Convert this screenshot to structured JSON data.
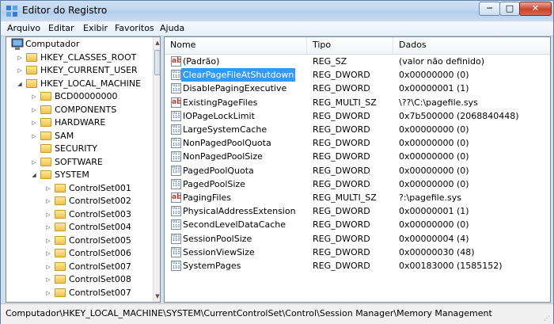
{
  "window": {
    "title": "Editor do Registro",
    "controls": {
      "minimize": "─",
      "maximize": "□",
      "close": "✕"
    }
  },
  "menu": [
    "Arquivo",
    "Editar",
    "Exibir",
    "Favoritos",
    "Ajuda"
  ],
  "tree": [
    {
      "label": "Computador",
      "level": 0,
      "expander": "expanded",
      "icon": "computer-icon"
    },
    {
      "label": "HKEY_CLASSES_ROOT",
      "level": 1,
      "expander": "collapsed"
    },
    {
      "label": "HKEY_CURRENT_USER",
      "level": 1,
      "expander": "collapsed"
    },
    {
      "label": "HKEY_LOCAL_MACHINE",
      "level": 1,
      "expander": "expanded"
    },
    {
      "label": "BCD00000000",
      "level": 2,
      "expander": "collapsed"
    },
    {
      "label": "COMPONENTS",
      "level": 2,
      "expander": "collapsed"
    },
    {
      "label": "HARDWARE",
      "level": 2,
      "expander": "collapsed"
    },
    {
      "label": "SAM",
      "level": 2,
      "expander": "collapsed"
    },
    {
      "label": "SECURITY",
      "level": 2,
      "expander": "none"
    },
    {
      "label": "SOFTWARE",
      "level": 2,
      "expander": "collapsed"
    },
    {
      "label": "SYSTEM",
      "level": 2,
      "expander": "expanded"
    },
    {
      "label": "ControlSet001",
      "level": 3,
      "expander": "collapsed"
    },
    {
      "label": "ControlSet002",
      "level": 3,
      "expander": "collapsed"
    },
    {
      "label": "ControlSet003",
      "level": 3,
      "expander": "collapsed"
    },
    {
      "label": "ControlSet004",
      "level": 3,
      "expander": "collapsed"
    },
    {
      "label": "ControlSet005",
      "level": 3,
      "expander": "collapsed"
    },
    {
      "label": "ControlSet006",
      "level": 3,
      "expander": "collapsed"
    },
    {
      "label": "ControlSet007",
      "level": 3,
      "expander": "collapsed"
    },
    {
      "label": "ControlSet008",
      "level": 3,
      "expander": "collapsed"
    },
    {
      "label": "ControlSet007",
      "level": 3,
      "expander": "collapsed"
    }
  ],
  "columns": [
    "Nome",
    "Tipo",
    "Dados"
  ],
  "values": [
    {
      "name": "(Padrão)",
      "type": "REG_SZ",
      "data": "(valor não definido)",
      "icon": "string-value-icon"
    },
    {
      "name": "ClearPageFileAtShutdown",
      "type": "REG_DWORD",
      "data": "0x00000000 (0)",
      "icon": "binary-value-icon",
      "selected": true
    },
    {
      "name": "DisablePagingExecutive",
      "type": "REG_DWORD",
      "data": "0x00000001 (1)",
      "icon": "binary-value-icon"
    },
    {
      "name": "ExistingPageFiles",
      "type": "REG_MULTI_SZ",
      "data": "\\??\\C:\\pagefile.sys",
      "icon": "string-value-icon"
    },
    {
      "name": "IOPageLockLimit",
      "type": "REG_DWORD",
      "data": "0x7b500000 (2068840448)",
      "icon": "binary-value-icon"
    },
    {
      "name": "LargeSystemCache",
      "type": "REG_DWORD",
      "data": "0x00000000 (0)",
      "icon": "binary-value-icon"
    },
    {
      "name": "NonPagedPoolQuota",
      "type": "REG_DWORD",
      "data": "0x00000000 (0)",
      "icon": "binary-value-icon"
    },
    {
      "name": "NonPagedPoolSize",
      "type": "REG_DWORD",
      "data": "0x00000000 (0)",
      "icon": "binary-value-icon"
    },
    {
      "name": "PagedPoolQuota",
      "type": "REG_DWORD",
      "data": "0x00000000 (0)",
      "icon": "binary-value-icon"
    },
    {
      "name": "PagedPoolSize",
      "type": "REG_DWORD",
      "data": "0x00000000 (0)",
      "icon": "binary-value-icon"
    },
    {
      "name": "PagingFiles",
      "type": "REG_MULTI_SZ",
      "data": "?:\\pagefile.sys",
      "icon": "string-value-icon"
    },
    {
      "name": "PhysicalAddressExtension",
      "type": "REG_DWORD",
      "data": "0x00000001 (1)",
      "icon": "binary-value-icon"
    },
    {
      "name": "SecondLevelDataCache",
      "type": "REG_DWORD",
      "data": "0x00000000 (0)",
      "icon": "binary-value-icon"
    },
    {
      "name": "SessionPoolSize",
      "type": "REG_DWORD",
      "data": "0x00000004 (4)",
      "icon": "binary-value-icon"
    },
    {
      "name": "SessionViewSize",
      "type": "REG_DWORD",
      "data": "0x00000030 (48)",
      "icon": "binary-value-icon"
    },
    {
      "name": "SystemPages",
      "type": "REG_DWORD",
      "data": "0x00183000 (1585152)",
      "icon": "binary-value-icon"
    }
  ],
  "status": "Computador\\HKEY_LOCAL_MACHINE\\SYSTEM\\CurrentControlSet\\Control\\Session Manager\\Memory Management",
  "colors": {
    "selection": "#3399ff",
    "title_bar": "#bcd4ee",
    "folder": "#f1c34b"
  }
}
